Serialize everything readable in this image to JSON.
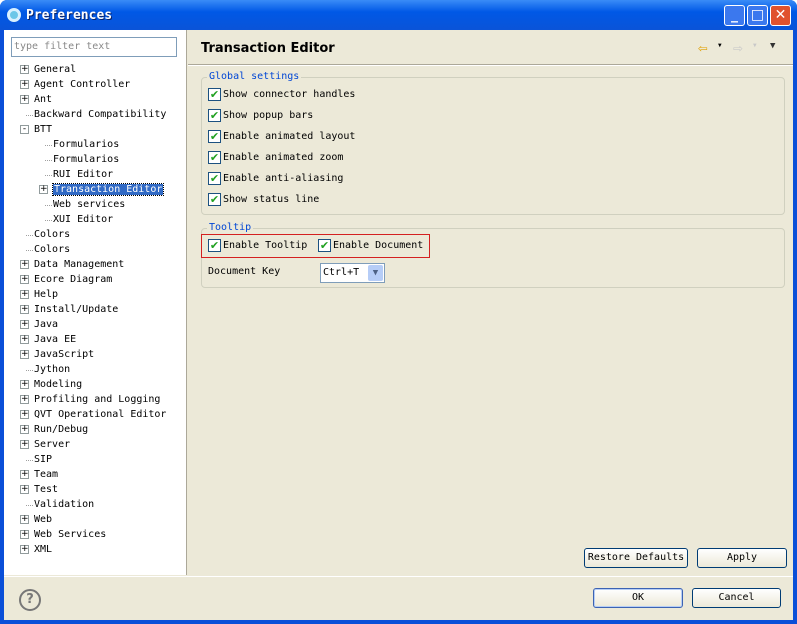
{
  "window": {
    "title": "Preferences",
    "minimize": "_",
    "maximize": "□",
    "close": "✕"
  },
  "filter": {
    "placeholder": "type filter text"
  },
  "tree": [
    {
      "label": "General",
      "exp": "+",
      "level": 0
    },
    {
      "label": "Agent Controller",
      "exp": "+",
      "level": 0
    },
    {
      "label": "Ant",
      "exp": "+",
      "level": 0
    },
    {
      "label": "Backward Compatibility",
      "exp": "",
      "level": 0
    },
    {
      "label": "BTT",
      "exp": "-",
      "level": 0
    },
    {
      "label": "Formularios",
      "exp": "",
      "level": 1
    },
    {
      "label": "Formularios",
      "exp": "",
      "level": 1
    },
    {
      "label": "RUI Editor",
      "exp": "",
      "level": 1
    },
    {
      "label": "Transaction Editor",
      "exp": "+",
      "level": 1,
      "selected": true
    },
    {
      "label": "Web services",
      "exp": "",
      "level": 1
    },
    {
      "label": "XUI Editor",
      "exp": "",
      "level": 1
    },
    {
      "label": "Colors",
      "exp": "",
      "level": 0
    },
    {
      "label": "Colors",
      "exp": "",
      "level": 0
    },
    {
      "label": "Data Management",
      "exp": "+",
      "level": 0
    },
    {
      "label": "Ecore Diagram",
      "exp": "+",
      "level": 0
    },
    {
      "label": "Help",
      "exp": "+",
      "level": 0
    },
    {
      "label": "Install/Update",
      "exp": "+",
      "level": 0
    },
    {
      "label": "Java",
      "exp": "+",
      "level": 0
    },
    {
      "label": "Java EE",
      "exp": "+",
      "level": 0
    },
    {
      "label": "JavaScript",
      "exp": "+",
      "level": 0
    },
    {
      "label": "Jython",
      "exp": "",
      "level": 0
    },
    {
      "label": "Modeling",
      "exp": "+",
      "level": 0
    },
    {
      "label": "Profiling and Logging",
      "exp": "+",
      "level": 0
    },
    {
      "label": "QVT Operational Editor",
      "exp": "+",
      "level": 0
    },
    {
      "label": "Run/Debug",
      "exp": "+",
      "level": 0
    },
    {
      "label": "Server",
      "exp": "+",
      "level": 0
    },
    {
      "label": "SIP",
      "exp": "",
      "level": 0
    },
    {
      "label": "Team",
      "exp": "+",
      "level": 0
    },
    {
      "label": "Test",
      "exp": "+",
      "level": 0
    },
    {
      "label": "Validation",
      "exp": "",
      "level": 0
    },
    {
      "label": "Web",
      "exp": "+",
      "level": 0
    },
    {
      "label": "Web Services",
      "exp": "+",
      "level": 0
    },
    {
      "label": "XML",
      "exp": "+",
      "level": 0
    }
  ],
  "page": {
    "title": "Transaction Editor",
    "back_icon": "⇦",
    "forward_icon": "⇨",
    "menu_icon": "▼"
  },
  "global": {
    "label": "Global settings",
    "options": [
      {
        "label": "Show connector handles",
        "checked": true
      },
      {
        "label": "Show popup bars",
        "checked": true
      },
      {
        "label": "Enable animated layout",
        "checked": true
      },
      {
        "label": "Enable animated zoom",
        "checked": true
      },
      {
        "label": "Enable anti-aliasing",
        "checked": true
      },
      {
        "label": "Show status line",
        "checked": true
      }
    ]
  },
  "tooltip": {
    "label": "Tooltip",
    "enable_tooltip": "Enable Tooltip",
    "enable_document": "Enable Document",
    "document_key_label": "Document Key",
    "document_key_value": "Ctrl+T",
    "highlight_color": "#d42020"
  },
  "buttons": {
    "restore": "Restore Defaults",
    "apply": "Apply",
    "ok": "OK",
    "cancel": "Cancel",
    "help": "?"
  }
}
